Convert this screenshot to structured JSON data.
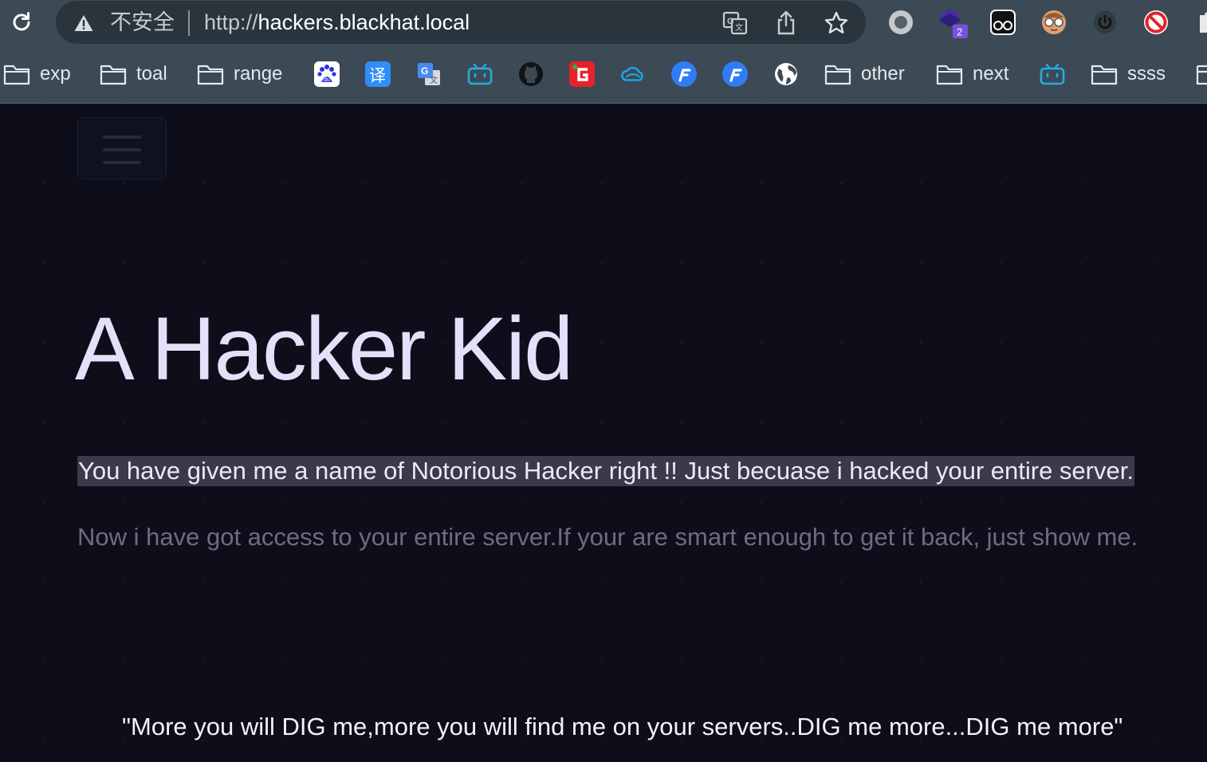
{
  "browser": {
    "security_label": "不安全",
    "url_scheme": "http://",
    "url_host": "hackers.blackhat.local",
    "extension_badge": "2",
    "icons": {
      "reload": "reload-icon",
      "warning": "warning-triangle-icon",
      "translate": "translate-icon",
      "share": "share-icon",
      "bookmark": "star-icon",
      "extensions": [
        "record-icon",
        "layers-extension-icon",
        "eyes-extension-icon",
        "glasses-face-extension-icon",
        "power-icon",
        "block-icon",
        "puzzle-icon"
      ]
    }
  },
  "bookmarks": {
    "folders": [
      "exp",
      "toal",
      "range",
      "other",
      "next",
      "ssss"
    ],
    "items": [
      "baidu-icon",
      "translate-yi-icon",
      "google-translate-icon",
      "bilibili-icon",
      "github-icon",
      "g-logo-icon",
      "cloud-icon",
      "f-logo-icon",
      "f-logo-icon",
      "globe-icon",
      "bilibili-icon"
    ]
  },
  "page": {
    "title": "A Hacker Kid",
    "lead": "You have given me a name of Notorious Hacker right !! Just becuase i hacked your entire server.",
    "paragraph": "Now i have got access to your entire server.If your are smart enough to get it back, just show me.",
    "quote": "\"More you will DIG me,more you will find me on your servers..DIG me more...DIG me more\""
  },
  "colors": {
    "page_background": "#0d0e1a",
    "title_text": "#e4e0fa",
    "lead_highlight": "#3a3a48",
    "muted_text": "#6e6c7e",
    "chrome_background": "#3c4a55"
  }
}
